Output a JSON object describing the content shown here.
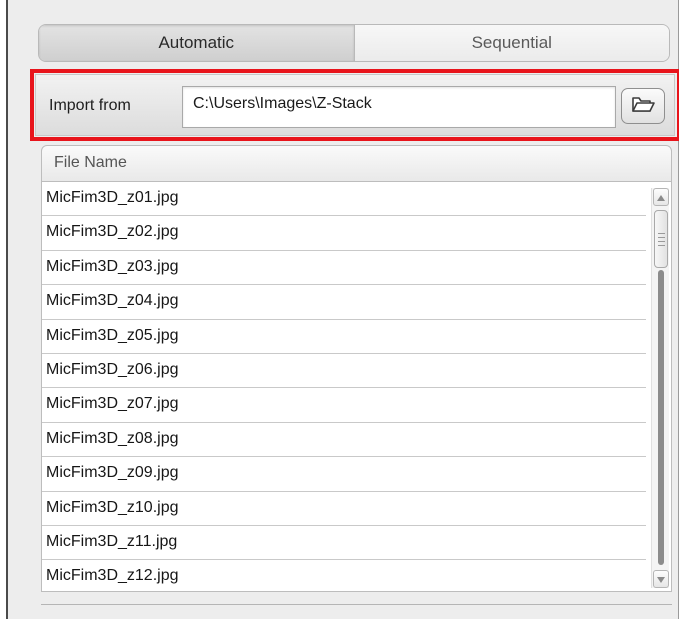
{
  "tabs": [
    {
      "label": "Automatic",
      "active": true
    },
    {
      "label": "Sequential",
      "active": false
    }
  ],
  "import": {
    "label": "Import from",
    "path": "C:\\Users\\Images\\Z-Stack",
    "browse_icon": "folder-open-icon"
  },
  "file_list": {
    "header": "File Name",
    "rows": [
      "MicFim3D_z01.jpg",
      "MicFim3D_z02.jpg",
      "MicFim3D_z03.jpg",
      "MicFim3D_z04.jpg",
      "MicFim3D_z05.jpg",
      "MicFim3D_z06.jpg",
      "MicFim3D_z07.jpg",
      "MicFim3D_z08.jpg",
      "MicFim3D_z09.jpg",
      "MicFim3D_z10.jpg",
      "MicFim3D_z11.jpg",
      "MicFim3D_z12.jpg"
    ]
  },
  "colors": {
    "highlight": "#e8141b",
    "panel_bg": "#ededed"
  }
}
